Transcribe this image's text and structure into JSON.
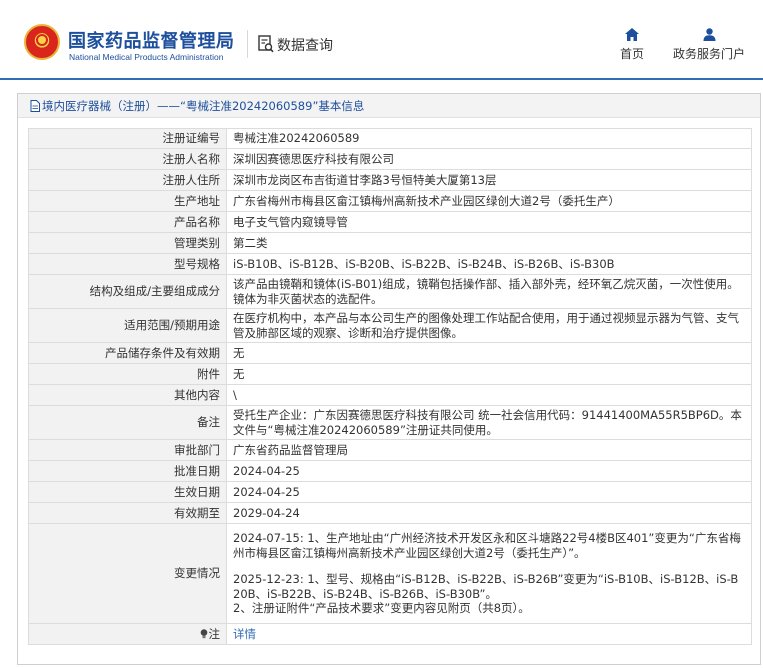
{
  "header": {
    "brand_cn": "国家药品监督管理局",
    "brand_en": "National Medical Products Administration",
    "section_title": "数据查询",
    "nav": {
      "home_label": "首页",
      "portal_label": "政务服务门户"
    }
  },
  "breadcrumb": {
    "text": "境内医疗器械（注册）——“粤械注准20242060589”基本信息"
  },
  "fields": [
    {
      "label": "注册证编号",
      "value": "粤械注准20242060589"
    },
    {
      "label": "注册人名称",
      "value": "深圳因赛德思医疗科技有限公司"
    },
    {
      "label": "注册人住所",
      "value": "深圳市龙岗区布吉街道甘李路3号恒特美大厦第13层"
    },
    {
      "label": "生产地址",
      "value": "广东省梅州市梅县区畲江镇梅州高新技术产业园区绿创大道2号（委托生产）"
    },
    {
      "label": "产品名称",
      "value": "电子支气管内窥镜导管"
    },
    {
      "label": "管理类别",
      "value": "第二类"
    },
    {
      "label": "型号规格",
      "value": "iS-B10B、iS-B12B、iS-B20B、iS-B22B、iS-B24B、iS-B26B、iS-B30B"
    },
    {
      "label": "结构及组成/主要组成成分",
      "value": "该产品由镜鞘和镜体(iS-B01)组成，镜鞘包括操作部、插入部外壳，经环氧乙烷灭菌，一次性使用。镜体为非灭菌状态的选配件。"
    },
    {
      "label": "适用范围/预期用途",
      "value": "在医疗机构中，本产品与本公司生产的图像处理工作站配合使用，用于通过视频显示器为气管、支气管及肺部区域的观察、诊断和治疗提供图像。"
    },
    {
      "label": "产品储存条件及有效期",
      "value": "无"
    },
    {
      "label": "附件",
      "value": "无"
    },
    {
      "label": "其他内容",
      "value": "\\"
    },
    {
      "label": "备注",
      "value": "受托生产企业：广东因赛德思医疗科技有限公司 统一社会信用代码：91441400MA55R5BP6D。本文件与“粤械注准20242060589”注册证共同使用。"
    },
    {
      "label": "审批部门",
      "value": "广东省药品监督管理局"
    },
    {
      "label": "批准日期",
      "value": "2024-04-25"
    },
    {
      "label": "生效日期",
      "value": "2024-04-25"
    },
    {
      "label": "有效期至",
      "value": "2029-04-24"
    }
  ],
  "changes": {
    "label": "变更情况",
    "entry1": "2024-07-15: 1、生产地址由“广州经济技术开发区永和区斗塘路22号4楼B区401”变更为“广东省梅州市梅县区畲江镇梅州高新技术产业园区绿创大道2号（委托生产）”。",
    "entry2_line1": "2025-12-23: 1、型号、规格由“iS-B12B、iS-B22B、iS-B26B”变更为“iS-B10B、iS-B12B、iS-B20B、iS-B22B、iS-B24B、iS-B26B、iS-B30B”。",
    "entry2_line2": "2、注册证附件“产品技术要求”变更内容见附页（共8页）。"
  },
  "note": {
    "label": "注",
    "link_text": "详情"
  },
  "colors": {
    "brand_blue": "#1d4f9c",
    "link_blue": "#2f6db5",
    "label_bg": "#f2f2f2",
    "emblem_red": "#d9251c"
  },
  "icons": {
    "emblem": "national-emblem-icon",
    "data_query": "document-search-icon",
    "home": "home-icon",
    "portal": "user-icon",
    "breadcrumb": "document-icon",
    "note": "lightbulb-icon"
  }
}
